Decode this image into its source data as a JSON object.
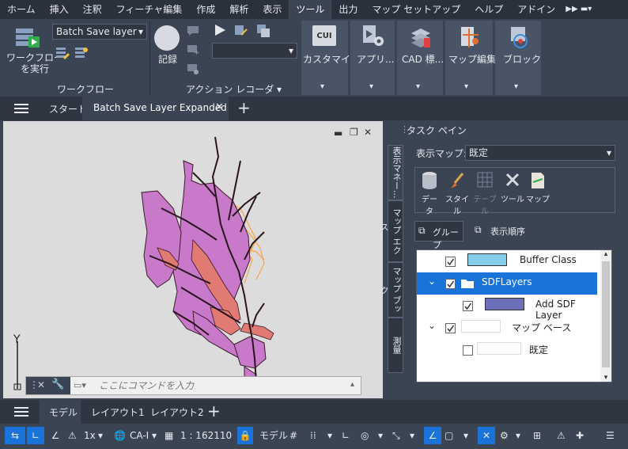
{
  "menu": {
    "items": [
      "ホーム",
      "挿入",
      "注釈",
      "フィーチャ編集",
      "作成",
      "解析",
      "表示",
      "ツール",
      "出力",
      "マップ セットアップ",
      "ヘルプ",
      "アドイン"
    ],
    "active": "ツール"
  },
  "ribbon": {
    "workflow_run_label": "ワークフロー\nを実行",
    "workflow_dropdown": "Batch Save layer",
    "workflow_group": "ワークフロー",
    "record_label": "記録",
    "action_recorder_group": "アクション レコーダ ▾",
    "customize_label": "カスタマイズ",
    "app_label": "アプリ...",
    "cad_label": "CAD 標...",
    "map_edit_label": "マップ編集",
    "block_label": "ブロック",
    "cui_badge": "CUI"
  },
  "doctabs": {
    "start": "スタート",
    "active_tab": "Batch Save Layer Expanded"
  },
  "viewport": {
    "command_placeholder": "ここにコマンドを入力",
    "ucs_y": "Y",
    "ucs_x": "X"
  },
  "taskpane": {
    "title": "タスク ペイン",
    "display_map_label": "表示マップ:",
    "display_map_value": "既定",
    "vtabs": [
      "表示マネー...",
      "マップ エクス...",
      "マップ ブック",
      "測量"
    ],
    "tools": [
      "データ",
      "スタイル",
      "テーブル",
      "ツール",
      "マップ"
    ],
    "group_btn": "グループ",
    "draw_order_btn": "表示順序",
    "layers": [
      {
        "name": "Buffer Class",
        "checked": true,
        "indent": 1,
        "swatch": "#87ceeb",
        "selected": false
      },
      {
        "name": "SDFLayers",
        "checked": true,
        "indent": 0,
        "folder": true,
        "selected": true
      },
      {
        "name": "Add SDF Layer",
        "checked": true,
        "indent": 1,
        "swatch": "#6c70b8",
        "selected": false
      },
      {
        "name": "マップ ベース",
        "checked": true,
        "indent": 0,
        "swatch": "#ffffff",
        "selected": false
      },
      {
        "name": "既定",
        "checked": false,
        "indent": 1,
        "swatch": "#ffffff",
        "selected": false
      }
    ]
  },
  "status": {
    "tabs": [
      "モデル",
      "レイアウト1",
      "レイアウト2"
    ],
    "active_tab": "モデル"
  },
  "bottombar": {
    "scale": "1x",
    "coord_sys": "CA-I",
    "map_scale": "1 : 162110",
    "model": "モデル"
  }
}
